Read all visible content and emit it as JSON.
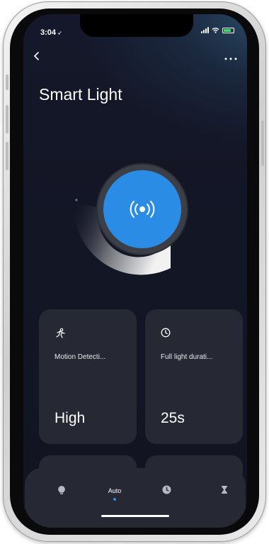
{
  "status_bar": {
    "time": "3:04"
  },
  "header": {
    "back_icon": "chevron-left-icon",
    "more_icon": "more-icon",
    "title": "Smart Light"
  },
  "dial": {
    "icon": "broadcast-icon",
    "color": "#2b8ce6"
  },
  "cards": [
    {
      "icon": "motion-icon",
      "label": "Motion Detecti...",
      "value": "High"
    },
    {
      "icon": "clock-icon",
      "label": "Full light durati...",
      "value": "25s"
    }
  ],
  "tabbar": {
    "tabs": [
      {
        "icon": "bulb-icon",
        "label": ""
      },
      {
        "icon": "",
        "label": "Auto",
        "selected": true
      },
      {
        "icon": "clock-icon",
        "label": ""
      },
      {
        "icon": "hourglass-icon",
        "label": ""
      }
    ],
    "accent": "#2b8ce6"
  }
}
